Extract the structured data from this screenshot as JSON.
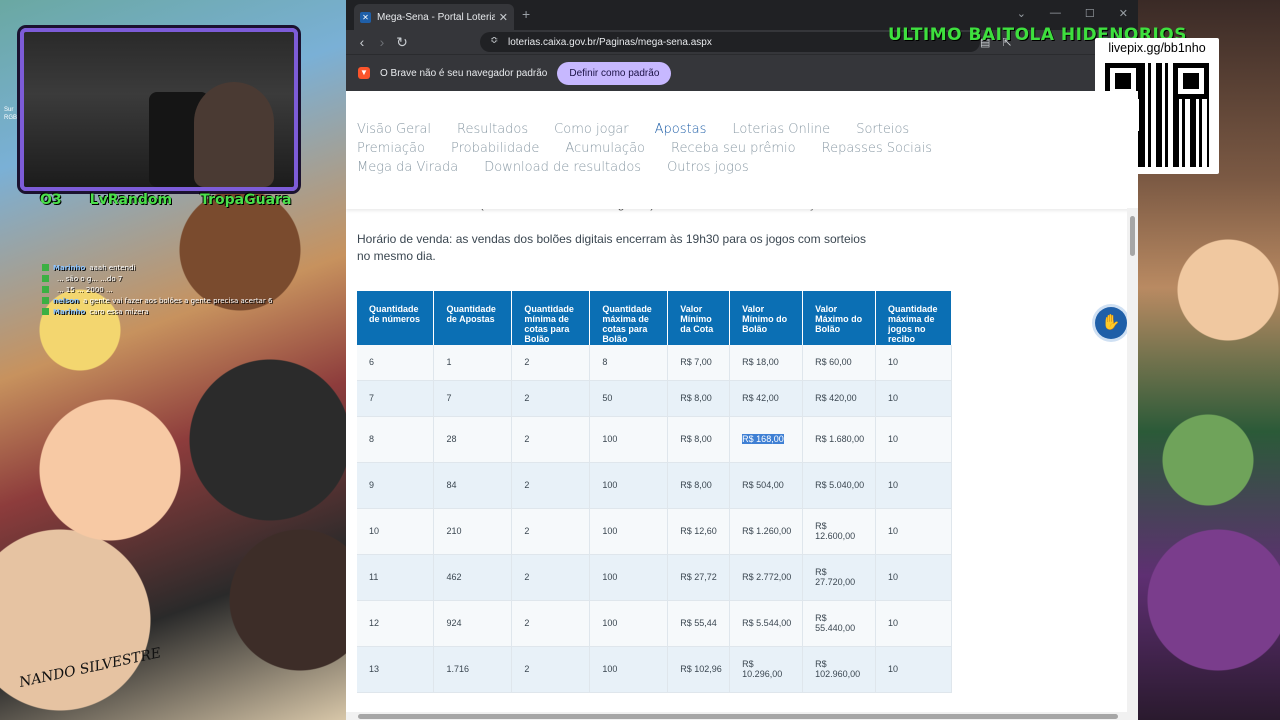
{
  "overlay": {
    "stream_names": [
      "O3",
      "LvRandom",
      "TropaGuara"
    ],
    "banner": "ULTIMO BAITOLA HIDENORIOS",
    "livepix": "livepix.gg/bb1nho",
    "signature": "NANDO SILVESTRE",
    "chat": [
      {
        "user": "Marinho",
        "text": "aaah entendi"
      },
      {
        "user": "",
        "text": "... são o g... ...do 7"
      },
      {
        "user": "",
        "text": "... 15 ... 2000 ..."
      },
      {
        "user": "nelson",
        "text": "a gente vai fazer aos bolões a gente precisa acertar 6"
      },
      {
        "user": "Marinho",
        "text": "caro essa mizera"
      }
    ]
  },
  "browser": {
    "tab_title": "Mega-Sena - Portal Loterias | CAIXA",
    "url": "loterias.caixa.gov.br/Paginas/mega-sena.aspx",
    "infobar_text": "O Brave não é seu navegador padrão",
    "infobar_button": "Definir como padrão"
  },
  "site_nav": {
    "items": [
      "Visão Geral",
      "Resultados",
      "Como jogar",
      "Apostas",
      "Loterias Online",
      "Sorteios",
      "Premiação",
      "Probabilidade",
      "Acumulação",
      "Receba seu prêmio",
      "Repasses Sociais",
      "Mega da Virada",
      "Download de resultados",
      "Outros jogos"
    ],
    "active": "Apostas"
  },
  "content": {
    "cut_line": "Loterias Online CAIXA (www.loteriasonline.caixa.gov.br) com a mesma tarifa do serviço adicional.",
    "sales_text": "Horário de venda: as vendas dos bolões digitais encerram às 19h30 para os jogos com sorteios no mesmo dia."
  },
  "table": {
    "headers": [
      "Quantidade de números",
      "Quantidade de Apostas",
      "Quantidade mínima de cotas para Bolão",
      "Quantidade máxima de cotas para Bolão",
      "Valor Mínimo da Cota",
      "Valor Mínimo do Bolão",
      "Valor Máximo do Bolão",
      "Quantidade máxima de jogos no recibo"
    ],
    "rows": [
      [
        "6",
        "1",
        "2",
        "8",
        "R$ 7,00",
        "R$ 18,00",
        "R$ 60,00",
        "10"
      ],
      [
        "7",
        "7",
        "2",
        "50",
        "R$ 8,00",
        "R$ 42,00",
        "R$ 420,00",
        "10"
      ],
      [
        "8",
        "28",
        "2",
        "100",
        "R$ 8,00",
        "R$ 168,00",
        "R$ 1.680,00",
        "10"
      ],
      [
        "9",
        "84",
        "2",
        "100",
        "R$ 8,00",
        "R$ 504,00",
        "R$ 5.040,00",
        "10"
      ],
      [
        "10",
        "210",
        "2",
        "100",
        "R$ 12,60",
        "R$ 1.260,00",
        "R$ 12.600,00",
        "10"
      ],
      [
        "11",
        "462",
        "2",
        "100",
        "R$ 27,72",
        "R$ 2.772,00",
        "R$ 27.720,00",
        "10"
      ],
      [
        "12",
        "924",
        "2",
        "100",
        "R$ 55,44",
        "R$ 5.544,00",
        "R$ 55.440,00",
        "10"
      ],
      [
        "13",
        "1.716",
        "2",
        "100",
        "R$ 102,96",
        "R$ 10.296,00",
        "R$ 102.960,00",
        "10"
      ]
    ],
    "highlighted_cell": "R$ 168,00"
  },
  "colors": {
    "table_header": "#0b6fb4",
    "nav_active": "#1f5fa8",
    "highlight": "#3f80d4"
  }
}
